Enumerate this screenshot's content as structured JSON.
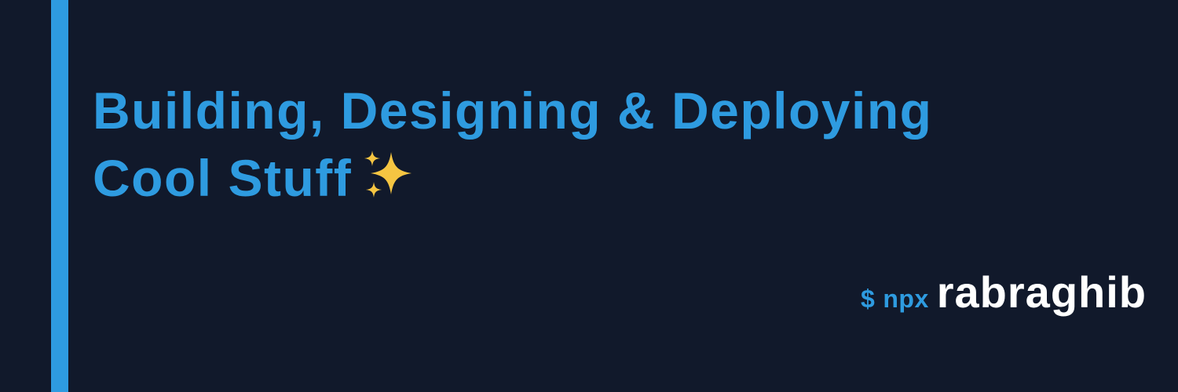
{
  "banner": {
    "headline_line1": "Building, Designing & Deploying",
    "headline_line2": "Cool Stuff",
    "headline_icon": "sparkles-icon",
    "prompt_symbol": "$",
    "command": "npx",
    "package_name": "rabraghib"
  },
  "colors": {
    "background": "#11192b",
    "accent": "#2e9be0",
    "package_text": "#ffffff",
    "sparkle": "#f5c542"
  }
}
